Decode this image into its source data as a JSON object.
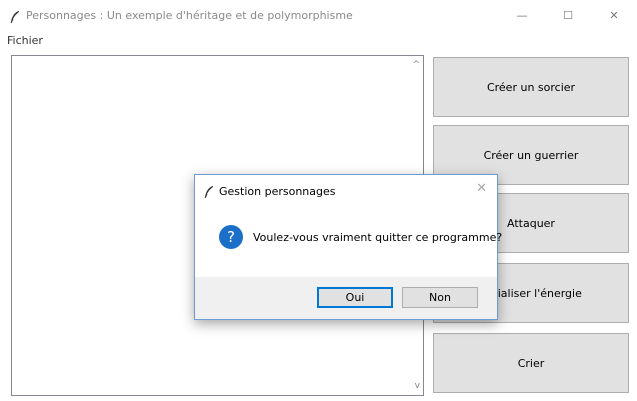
{
  "window": {
    "title": "Personnages : Un exemple d'héritage et de polymorphisme",
    "controls": {
      "minimize": "—",
      "maximize": "☐",
      "close": "✕"
    }
  },
  "menu": {
    "items": [
      "Fichier"
    ]
  },
  "listbox": {
    "scroll_up": "^",
    "scroll_down": "v"
  },
  "buttons": [
    {
      "label": "Créer un sorcier"
    },
    {
      "label": "Créer un guerrier"
    },
    {
      "label": "Attaquer"
    },
    {
      "label": "Initialiser l'énergie"
    },
    {
      "label": "Crier"
    }
  ],
  "dialog": {
    "title": "Gestion personnages",
    "close": "✕",
    "icon": "question-icon",
    "message": "Voulez-vous vraiment quitter ce programme?",
    "yes": "Oui",
    "no": "Non"
  },
  "colors": {
    "accent": "#0078d7",
    "button_face": "#e1e1e1",
    "dialog_footer": "#f0f0f0"
  }
}
